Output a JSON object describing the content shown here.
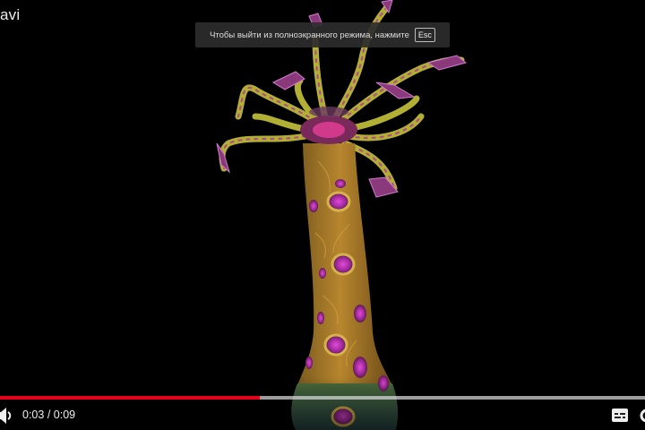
{
  "player": {
    "title": "avi",
    "fullscreen_notice": {
      "text": "Чтобы выйти из полноэкранного режима, нажмите",
      "key": "Esc"
    },
    "progress": {
      "played_fraction": 0.403,
      "loaded_fraction": 1.0
    },
    "time": {
      "current": "0:03",
      "separator": " / ",
      "duration": "0:09"
    },
    "icons": {
      "volume": "volume-icon",
      "subtitles": "subtitles-icon",
      "settings": "settings-icon"
    },
    "colors": {
      "progress_played": "#e4001b",
      "background": "#000000"
    }
  }
}
